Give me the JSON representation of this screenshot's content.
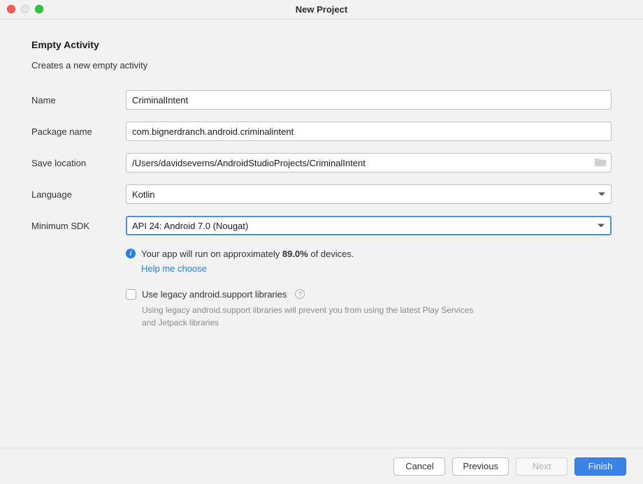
{
  "window": {
    "title": "New Project"
  },
  "section": {
    "heading": "Empty Activity",
    "description": "Creates a new empty activity"
  },
  "labels": {
    "name": "Name",
    "package": "Package name",
    "save": "Save location",
    "language": "Language",
    "minsdk": "Minimum SDK"
  },
  "fields": {
    "name": "CriminalIntent",
    "package": "com.bignerdranch.android.criminalintent",
    "save": "/Users/davidseverns/AndroidStudioProjects/CriminalIntent",
    "language": "Kotlin",
    "minsdk": "API 24: Android 7.0 (Nougat)"
  },
  "info": {
    "prefix": "Your app will run on approximately ",
    "percent": "89.0%",
    "suffix": " of devices.",
    "help_link": "Help me choose"
  },
  "legacy": {
    "label": "Use legacy android.support libraries",
    "desc": "Using legacy android.support libraries will prevent you from using the latest Play Services and Jetpack libraries"
  },
  "buttons": {
    "cancel": "Cancel",
    "previous": "Previous",
    "next": "Next",
    "finish": "Finish"
  }
}
